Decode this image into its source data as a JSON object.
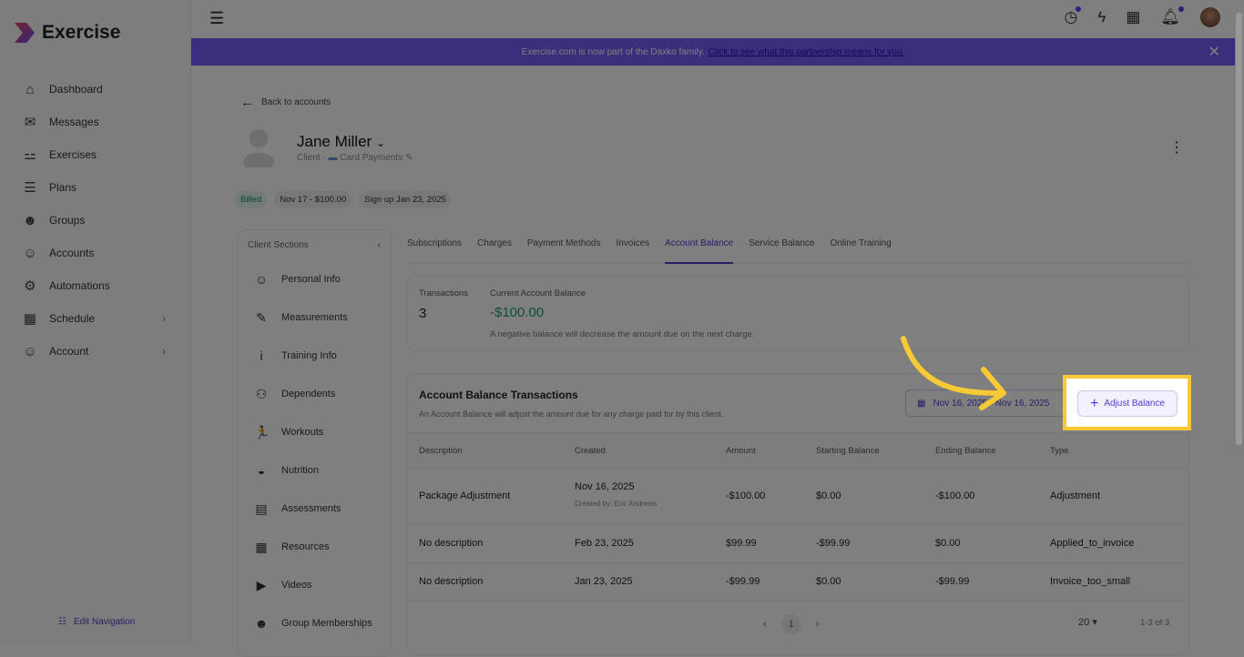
{
  "app": {
    "name": "Exercise"
  },
  "sidebar": {
    "items": [
      {
        "label": "Dashboard",
        "icon": "home-icon",
        "g": "⌂"
      },
      {
        "label": "Messages",
        "icon": "mail-icon",
        "g": "✉"
      },
      {
        "label": "Exercises",
        "icon": "dumbbell-icon",
        "g": "⚍"
      },
      {
        "label": "Plans",
        "icon": "clipboard-icon",
        "g": "☰"
      },
      {
        "label": "Groups",
        "icon": "users-icon",
        "g": "☻"
      },
      {
        "label": "Accounts",
        "icon": "user-icon",
        "g": "☺"
      },
      {
        "label": "Automations",
        "icon": "robot-icon",
        "g": "⚙"
      },
      {
        "label": "Schedule",
        "icon": "calendar-icon",
        "g": "▦"
      },
      {
        "label": "Account",
        "icon": "user-gear-icon",
        "g": "☺"
      }
    ],
    "edit_navigation": "Edit Navigation"
  },
  "banner": {
    "text": "Exercise.com is now part of the Daxko family.",
    "link": "Click to see what this partnership means for you."
  },
  "back": "Back to accounts",
  "client": {
    "name": "Jane Miller",
    "role": "Client",
    "payment": "Card Payments",
    "badges": [
      "Billed",
      "Nov 17 - $100.00",
      "Sign up Jan 23, 2025"
    ]
  },
  "client_sections": {
    "title": "Client Sections",
    "items": [
      {
        "label": "Personal Info",
        "g": "☺"
      },
      {
        "label": "Measurements",
        "g": "✎"
      },
      {
        "label": "Training Info",
        "g": "i"
      },
      {
        "label": "Dependents",
        "g": "⚇"
      },
      {
        "label": "Workouts",
        "g": "🏃"
      },
      {
        "label": "Nutrition",
        "g": "◒"
      },
      {
        "label": "Assessments",
        "g": "▤"
      },
      {
        "label": "Resources",
        "g": "▦"
      },
      {
        "label": "Videos",
        "g": "▶"
      },
      {
        "label": "Group Memberships",
        "g": "☻"
      }
    ]
  },
  "tabs": [
    "Subscriptions",
    "Charges",
    "Payment Methods",
    "Invoices",
    "Account Balance",
    "Service Balance",
    "Online Training"
  ],
  "summary": {
    "transactions_label": "Transactions",
    "transactions": "3",
    "balance_label": "Current Account Balance",
    "balance": "-$100.00",
    "note": "A negative balance will decrease the amount due on the next charge."
  },
  "transactions": {
    "title": "Account Balance Transactions",
    "subtitle": "An Account Balance will adjust the amount due for any charge paid for by this client.",
    "date_range": "Nov 16, 2025 - Nov 16, 2025",
    "adjust_label": "Adjust Balance",
    "columns": [
      "Description",
      "Created",
      "Amount",
      "Starting Balance",
      "Ending Balance",
      "Type"
    ],
    "rows": [
      [
        "Package Adjustment",
        "Nov 16, 2025",
        "-$100.00",
        "$0.00",
        "-$100.00",
        "Adjustment",
        "Created by: Eric Andrews"
      ],
      [
        "No description",
        "Feb 23, 2025",
        "$99.99",
        "-$99.99",
        "$0.00",
        "Applied_to_invoice",
        ""
      ],
      [
        "No description",
        "Jan 23, 2025",
        "-$99.99",
        "$0.00",
        "-$99.99",
        "Invoice_too_small",
        ""
      ]
    ],
    "page": "1",
    "per_page": "20",
    "range": "1-3 of 3"
  },
  "colors": {
    "accent": "#4b3fcf",
    "banner": "#7b5cf6",
    "highlight": "#f7c935",
    "balance": "#1a9a7a"
  }
}
